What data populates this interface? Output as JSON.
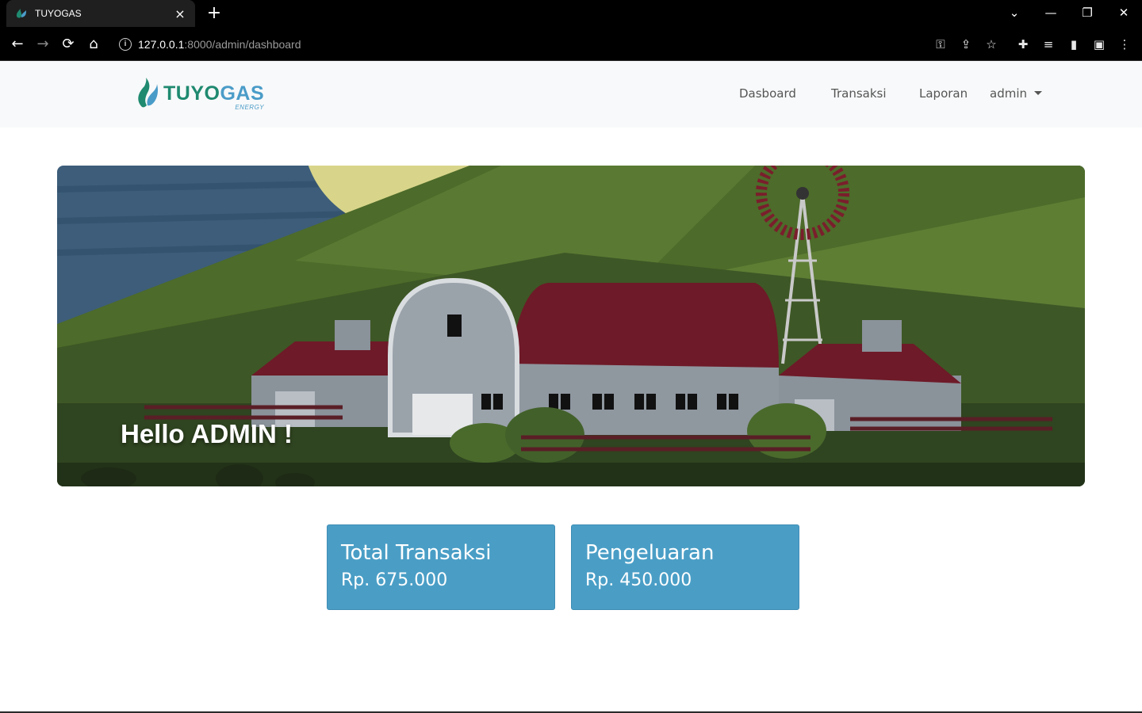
{
  "browser": {
    "tab_title": "TUYOGAS",
    "tab_close": "×",
    "new_tab": "+",
    "url_host": "127.0.0.1",
    "url_path": ":8000/admin/dashboard",
    "icons": {
      "back": "←",
      "forward": "→",
      "reload": "⟳",
      "home": "⌂",
      "key": "⚿",
      "share": "⇪",
      "star": "☆",
      "extensions": "✚",
      "media": "≡",
      "sidepanel": "▮",
      "profile": "▣",
      "menu": "⋮",
      "minimize": "—",
      "restore": "❐",
      "close": "✕",
      "tablist": "⌄"
    }
  },
  "navbar": {
    "logo_tuyo": "TUYO",
    "logo_gas": "GAS",
    "logo_sub": "ENERGY",
    "links": [
      "Dasboard",
      "Transaksi",
      "Laporan"
    ],
    "user_menu": "admin"
  },
  "hero": {
    "greeting": "Hello ADMIN !"
  },
  "cards": [
    {
      "title": "Total Transaksi",
      "value": "Rp. 675.000"
    },
    {
      "title": "Pengeluaran",
      "value": "Rp. 450.000"
    }
  ],
  "colors": {
    "card_bg": "#4a9ec6",
    "logo_green": "#1f8a70",
    "logo_blue": "#4a9cc8",
    "barn_roof": "#6e1a28",
    "hill_green": "#4d6b2a"
  }
}
